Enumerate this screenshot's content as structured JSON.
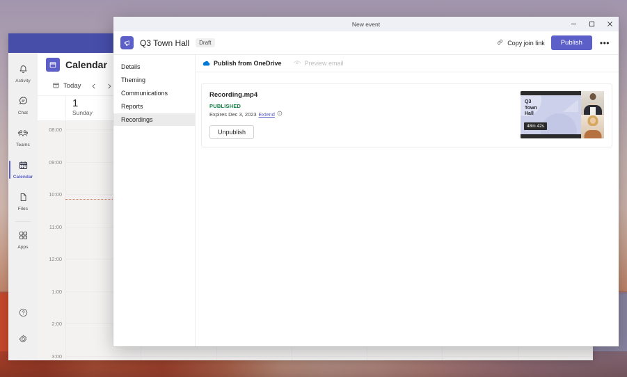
{
  "desktop": {
    "wallpaper_top_color": "#a296ae",
    "wallpaper_bottom_color": "#be3c20"
  },
  "teams_window": {
    "titlebar_color": "#464eaa",
    "app_rail": {
      "items": [
        {
          "label": "Activity",
          "icon": "bell-icon",
          "selected": false
        },
        {
          "label": "Chat",
          "icon": "chat-icon",
          "selected": false
        },
        {
          "label": "Teams",
          "icon": "people-icon",
          "selected": false
        },
        {
          "label": "Calendar",
          "icon": "calendar-icon",
          "selected": true
        },
        {
          "label": "Files",
          "icon": "file-icon",
          "selected": false
        },
        {
          "label": "Apps",
          "icon": "apps-icon",
          "selected": false
        }
      ],
      "bottom_items": [
        {
          "label": "Help",
          "icon": "help-circle-icon"
        },
        {
          "label": "Settings",
          "icon": "gear-icon"
        }
      ]
    },
    "calendar": {
      "app_icon": "calendar-icon",
      "title": "Calendar",
      "today_label": "Today",
      "today_icon": "calendar-today-icon",
      "prev_icon": "chevron-left-icon",
      "next_icon": "chevron-right-icon",
      "day_number": "1",
      "day_name": "Sunday",
      "time_labels": [
        "08:00",
        "09:00",
        "10:00",
        "11:00",
        "12:00",
        "1:00",
        "2:00",
        "3:00"
      ],
      "current_time_indicator_color": "#d9694f"
    }
  },
  "dialog": {
    "window_title": "New event",
    "window_buttons": {
      "minimize": "–",
      "maximize": "☐",
      "close": "✕"
    },
    "header": {
      "app_icon": "megaphone-icon",
      "event_title": "Q3 Town Hall",
      "badge": "Draft",
      "copy_join_link_icon": "link-icon",
      "copy_join_link_label": "Copy join link",
      "publish_label": "Publish",
      "publish_color": "#5b5fc7",
      "more_icon": "more-horizontal-icon",
      "more_label": "•••"
    },
    "nav": {
      "items": [
        {
          "label": "Details",
          "selected": false
        },
        {
          "label": "Theming",
          "selected": false
        },
        {
          "label": "Communications",
          "selected": false
        },
        {
          "label": "Reports",
          "selected": false
        },
        {
          "label": "Recordings",
          "selected": true
        }
      ]
    },
    "content": {
      "tabs": [
        {
          "label": "Publish from OneDrive",
          "icon": "onedrive-cloud-icon",
          "active": true,
          "disabled": false
        },
        {
          "label": "Preview email",
          "icon": "eye-preview-icon",
          "active": false,
          "disabled": true
        }
      ],
      "recording_card": {
        "filename": "Recording.mp4",
        "status": "PUBLISHED",
        "status_color": "#107c41",
        "expires_text": "Expires Dec 3, 2023",
        "extend_label": "Extend",
        "info_icon": "info-circle-icon",
        "unpublish_label": "Unpublish",
        "thumbnail": {
          "slide_title": "Q3\nTown\nHall",
          "slide_line_1": "Q3",
          "slide_line_2": "Town",
          "slide_line_3": "Hall",
          "duration": "48m 42s"
        }
      }
    }
  }
}
